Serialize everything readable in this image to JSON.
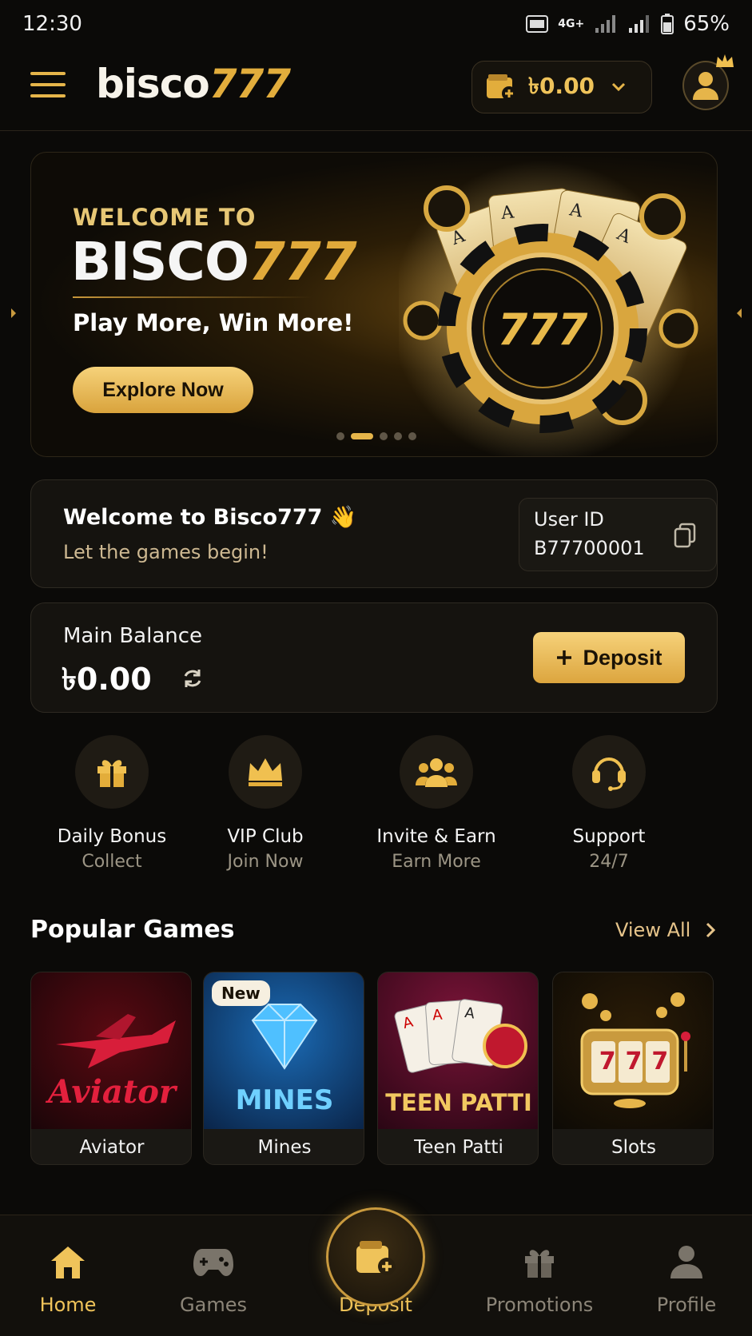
{
  "status_bar": {
    "time": "12:30",
    "network": "4G+",
    "battery": "65%"
  },
  "header": {
    "logo_main": "bisco",
    "logo_accent": "777",
    "balance": "৳0.00"
  },
  "hero": {
    "welcome": "WELCOME TO",
    "title_main": "BISCO",
    "title_accent": "777",
    "tagline": "Play More, Win More!",
    "cta": "Explore Now",
    "chip_text": "777",
    "slides": 5,
    "active_slide": 2
  },
  "welcome_card": {
    "title": "Welcome to Bisco777 👋",
    "subtitle": "Let the games begin!",
    "user_id_label": "User ID",
    "user_id": "B77700001"
  },
  "balance_card": {
    "label": "Main Balance",
    "amount": "৳0.00",
    "deposit_label": "Deposit"
  },
  "quick_actions": [
    {
      "title": "Daily Bonus",
      "subtitle": "Collect",
      "icon": "gift-icon"
    },
    {
      "title": "VIP Club",
      "subtitle": "Join Now",
      "icon": "crown-icon"
    },
    {
      "title": "Invite & Earn",
      "subtitle": "Earn More",
      "icon": "users-icon"
    },
    {
      "title": "Support",
      "subtitle": "24/7",
      "icon": "headset-icon"
    }
  ],
  "popular_games": {
    "title": "Popular Games",
    "view_all": "View All",
    "games": [
      {
        "name": "Aviator",
        "art_title": "Aviator",
        "badge": ""
      },
      {
        "name": "Mines",
        "art_title": "MINES",
        "badge": "New"
      },
      {
        "name": "Teen Patti",
        "art_title": "TEEN PATTI",
        "badge": ""
      },
      {
        "name": "Slots",
        "art_title": "777",
        "badge": ""
      }
    ]
  },
  "bottom_nav": [
    {
      "label": "Home",
      "icon": "home-icon",
      "active": true
    },
    {
      "label": "Games",
      "icon": "gamepad-icon",
      "active": false
    },
    {
      "label": "Deposit",
      "icon": "wallet-plus-icon",
      "active": true
    },
    {
      "label": "Promotions",
      "icon": "gift-icon",
      "active": false
    },
    {
      "label": "Profile",
      "icon": "user-icon",
      "active": false
    }
  ],
  "colors": {
    "accent": "#e6b54a",
    "background": "#0b0a08",
    "card": "#15130f"
  }
}
